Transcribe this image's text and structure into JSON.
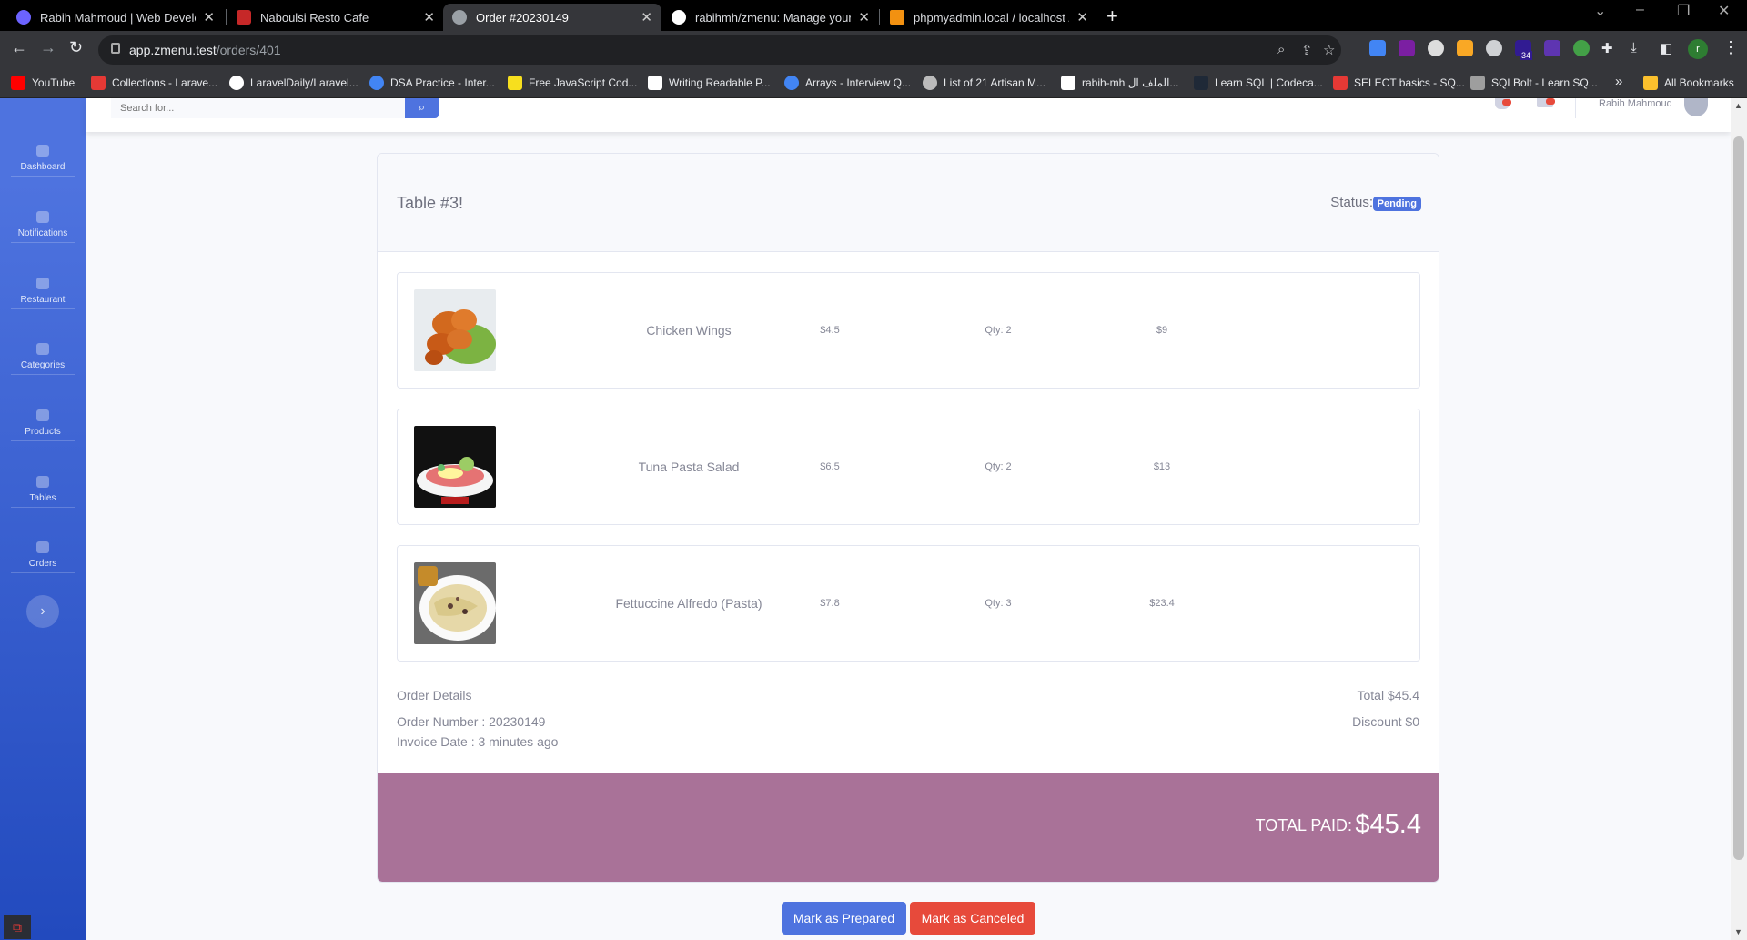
{
  "browser": {
    "tabs": [
      {
        "title": "Rabih Mahmoud | Web Develop",
        "active": false
      },
      {
        "title": "Naboulsi Resto Cafe",
        "active": false
      },
      {
        "title": "Order #20230149",
        "active": true
      },
      {
        "title": "rabihmh/zmenu: Manage your r",
        "active": false
      },
      {
        "title": "phpmyadmin.local / localhost / r",
        "active": false
      }
    ],
    "url_host": "app.zmenu.test",
    "url_path": "/orders/401",
    "bookmarks": [
      "YouTube",
      "Collections - Larave...",
      "LaravelDaily/Laravel...",
      "DSA Practice - Inter...",
      "Free JavaScript Cod...",
      "Writing Readable P...",
      "Arrays - Interview Q...",
      "List of 21 Artisan M...",
      "rabih-mh الملف ال...",
      "Learn SQL | Codeca...",
      "SELECT basics - SQ...",
      "SQLBolt - Learn SQ..."
    ],
    "all_bookmarks": "All Bookmarks",
    "extension_badge": "34",
    "profile_initial": "r"
  },
  "sidebar": {
    "items": [
      {
        "label": "Dashboard"
      },
      {
        "label": "Notifications"
      },
      {
        "label": "Restaurant"
      },
      {
        "label": "Categories"
      },
      {
        "label": "Products"
      },
      {
        "label": "Tables"
      },
      {
        "label": "Orders"
      }
    ],
    "toggle_icon": "›"
  },
  "topbar": {
    "search_placeholder": "Search for...",
    "user_name": "Rabih Mahmoud"
  },
  "order": {
    "table_title": "Table #3!",
    "status_label": "Status:",
    "status_value": "Pending",
    "items": [
      {
        "name": "Chicken Wings",
        "price": "$4.5",
        "qty": "Qty: 2",
        "total": "$9"
      },
      {
        "name": "Tuna Pasta Salad",
        "price": "$6.5",
        "qty": "Qty: 2",
        "total": "$13"
      },
      {
        "name": "Fettuccine Alfredo (Pasta)",
        "price": "$7.8",
        "qty": "Qty: 3",
        "total": "$23.4"
      }
    ],
    "details_title": "Order Details",
    "order_number": "Order Number : 20230149",
    "invoice_date": "Invoice Date : 3 minutes ago",
    "total": "Total $45.4",
    "discount": "Discount $0",
    "total_paid_label": "TOTAL PAID:",
    "total_paid_amount": "$45.4"
  },
  "actions": {
    "prepared_label": "Mark as Prepared",
    "cancel_label": "Mark as Canceled"
  },
  "colors": {
    "primary": "#4e73df",
    "danger": "#e74a3b",
    "paid_bar": "#a97298"
  }
}
